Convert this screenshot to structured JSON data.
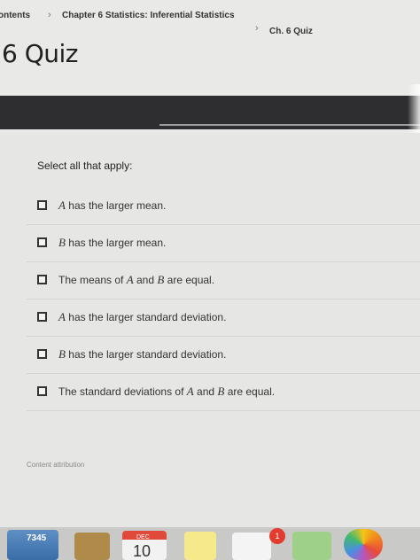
{
  "breadcrumb": {
    "item_1": "ontents",
    "item_2": "Chapter 6 Statistics: Inferential Statistics",
    "item_3": "Ch. 6 Quiz",
    "separator": "›"
  },
  "page": {
    "title": "6 Quiz"
  },
  "question": {
    "instruction": "Select all that apply:",
    "options": [
      {
        "var": "A",
        "text": " has the larger mean."
      },
      {
        "var": "B",
        "text": " has the larger mean."
      },
      {
        "pre": "The means of ",
        "var1": "A",
        "mid": " and ",
        "var2": "B",
        "post": " are equal."
      },
      {
        "var": "A",
        "text": " has the larger standard deviation."
      },
      {
        "var": "B",
        "text": " has the larger standard deviation."
      },
      {
        "pre": "The standard deviations of ",
        "var1": "A",
        "mid": " and ",
        "var2": "B",
        "post": " are equal."
      }
    ],
    "attribution": "Content attribution"
  },
  "dock": {
    "calls_count": "7345",
    "calendar_month": "DEC",
    "calendar_day": "10",
    "badge_count": "1"
  },
  "colors": {
    "dark_band": "#2e2e30",
    "badge": "#e33b2e"
  }
}
